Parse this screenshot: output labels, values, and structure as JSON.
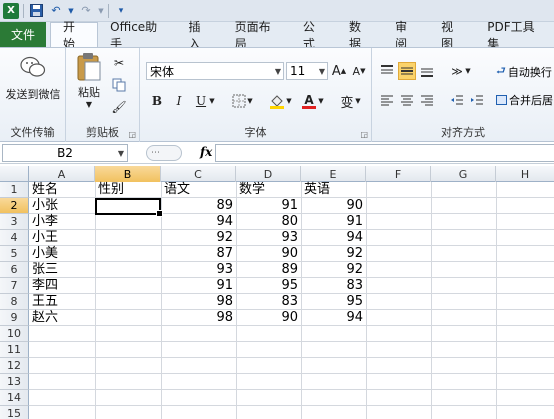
{
  "quick_access": {
    "app_icon": "X"
  },
  "ribbon_tabs": [
    {
      "label": "文件",
      "active": false
    },
    {
      "label": "开始",
      "active": true
    },
    {
      "label": "Office助手",
      "active": false
    },
    {
      "label": "插入",
      "active": false
    },
    {
      "label": "页面布局",
      "active": false
    },
    {
      "label": "公式",
      "active": false
    },
    {
      "label": "数据",
      "active": false
    },
    {
      "label": "审阅",
      "active": false
    },
    {
      "label": "视图",
      "active": false
    },
    {
      "label": "PDF工具集",
      "active": false
    }
  ],
  "ribbon": {
    "file_transfer": {
      "button": "发送到微信",
      "group": "文件传输"
    },
    "clipboard": {
      "paste": "粘贴",
      "group": "剪贴板"
    },
    "font": {
      "name": "宋体",
      "size": "11",
      "grow": "A",
      "shrink": "A",
      "bold": "B",
      "italic": "I",
      "underline": "U",
      "color_letter": "A",
      "wen": "变",
      "group": "字体"
    },
    "alignment": {
      "wrap": "自动换行",
      "merge": "合并后居",
      "group": "对齐方式"
    }
  },
  "formula_bar": {
    "name_box": "B2",
    "fx": "fx",
    "formula": ""
  },
  "grid": {
    "columns": [
      "A",
      "B",
      "C",
      "D",
      "E",
      "F",
      "G",
      "H"
    ],
    "selected_column": "B",
    "rows": [
      "1",
      "2",
      "3",
      "4",
      "5",
      "6",
      "7",
      "8",
      "9",
      "10",
      "11",
      "12",
      "13",
      "14",
      "15"
    ],
    "selected_row": "2",
    "headers": [
      "姓名",
      "性别",
      "语文",
      "数学",
      "英语"
    ],
    "data": [
      {
        "name": "小张",
        "gender": "",
        "chinese": "89",
        "math": "91",
        "english": "90"
      },
      {
        "name": "小李",
        "gender": "",
        "chinese": "94",
        "math": "80",
        "english": "91"
      },
      {
        "name": "小王",
        "gender": "",
        "chinese": "92",
        "math": "93",
        "english": "94"
      },
      {
        "name": "小美",
        "gender": "",
        "chinese": "87",
        "math": "90",
        "english": "92"
      },
      {
        "name": "张三",
        "gender": "",
        "chinese": "93",
        "math": "89",
        "english": "92"
      },
      {
        "name": "李四",
        "gender": "",
        "chinese": "91",
        "math": "95",
        "english": "83"
      },
      {
        "name": "王五",
        "gender": "",
        "chinese": "98",
        "math": "83",
        "english": "95"
      },
      {
        "name": "赵六",
        "gender": "",
        "chinese": "98",
        "math": "90",
        "english": "94"
      }
    ]
  },
  "colors": {
    "file_tab": "#2b7a36",
    "selection": "#f1c15f"
  }
}
